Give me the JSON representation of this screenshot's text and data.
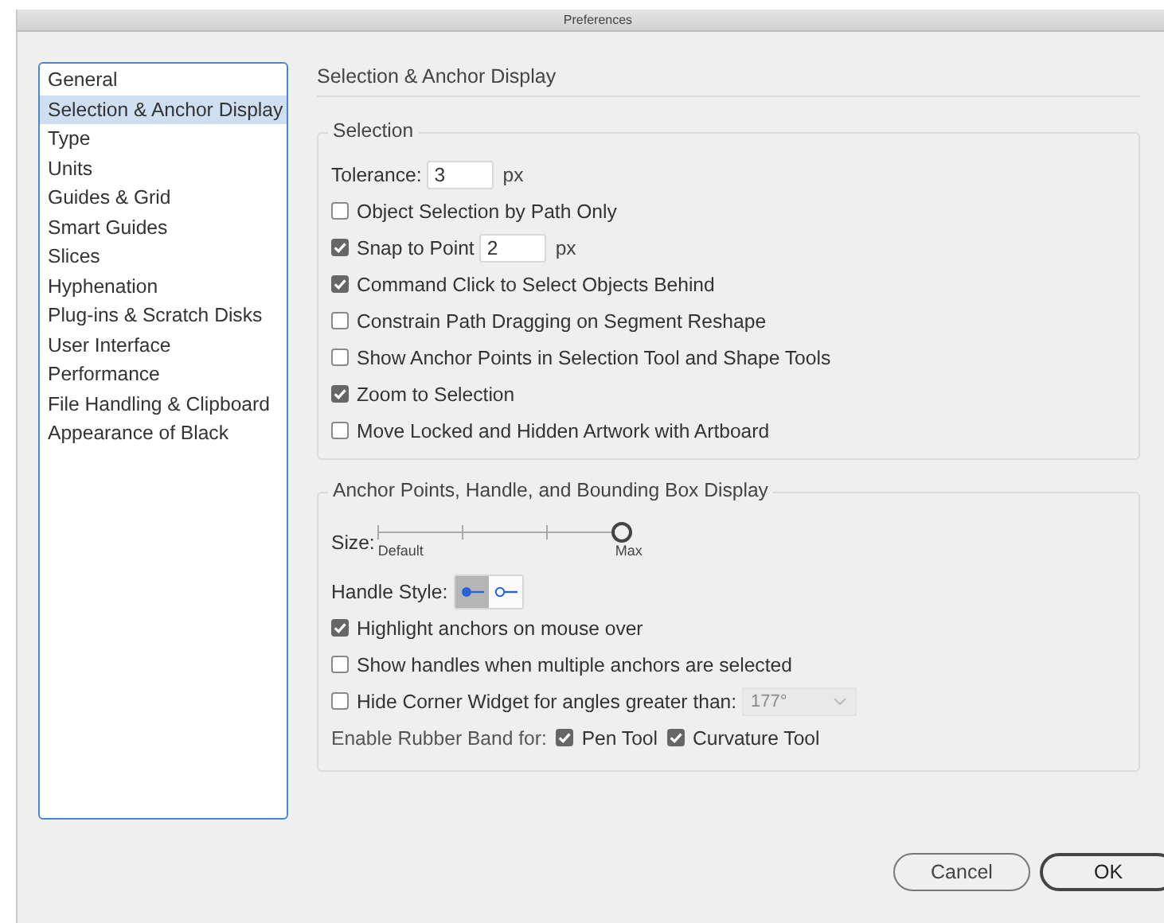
{
  "window": {
    "title": "Preferences"
  },
  "sidebar": {
    "items": [
      {
        "label": "General",
        "selected": false
      },
      {
        "label": "Selection & Anchor Display",
        "selected": true
      },
      {
        "label": "Type",
        "selected": false
      },
      {
        "label": "Units",
        "selected": false
      },
      {
        "label": "Guides & Grid",
        "selected": false
      },
      {
        "label": "Smart Guides",
        "selected": false
      },
      {
        "label": "Slices",
        "selected": false
      },
      {
        "label": "Hyphenation",
        "selected": false
      },
      {
        "label": "Plug-ins & Scratch Disks",
        "selected": false
      },
      {
        "label": "User Interface",
        "selected": false
      },
      {
        "label": "Performance",
        "selected": false
      },
      {
        "label": "File Handling & Clipboard",
        "selected": false
      },
      {
        "label": "Appearance of Black",
        "selected": false
      }
    ]
  },
  "panel_title": "Selection & Anchor Display",
  "selection": {
    "title": "Selection",
    "rows": [
      {
        "kind": "field",
        "label": "Tolerance:",
        "value": "3",
        "unit": "px"
      },
      {
        "kind": "checkbox",
        "label": "Object Selection by Path Only",
        "checked": false
      },
      {
        "kind": "checkbox_field",
        "label": "Snap to Point",
        "checked": true,
        "value": "2",
        "unit": "px"
      },
      {
        "kind": "checkbox",
        "label": "Command Click to Select Objects Behind",
        "checked": true
      },
      {
        "kind": "checkbox",
        "label": "Constrain Path Dragging on Segment Reshape",
        "checked": false
      },
      {
        "kind": "checkbox",
        "label": "Show Anchor Points in Selection Tool and Shape Tools",
        "checked": false
      },
      {
        "kind": "checkbox",
        "label": "Zoom to Selection",
        "checked": true
      },
      {
        "kind": "checkbox",
        "label": "Move Locked and Hidden Artwork with Artboard",
        "checked": false
      }
    ]
  },
  "anchor": {
    "title": "Anchor Points, Handle, and Bounding Box Display",
    "size": {
      "label": "Size:",
      "level": 1,
      "min_label": "Default",
      "max_label": "Max"
    },
    "handle_style": {
      "label": "Handle Style:",
      "options": [
        {
          "kind": "solid",
          "selected": true
        },
        {
          "kind": "hollow",
          "selected": false
        }
      ]
    },
    "rows": [
      {
        "kind": "checkbox",
        "label": "Highlight anchors on mouse over",
        "checked": true
      },
      {
        "kind": "checkbox",
        "label": "Show handles when multiple anchors are selected",
        "checked": false
      },
      {
        "kind": "checkbox_select",
        "label": "Hide Corner Widget for angles greater than:",
        "checked": false,
        "value": "177°",
        "disabled": true
      }
    ],
    "rubber_band": {
      "label": "Enable Rubber Band for:",
      "options": [
        {
          "label": "Pen Tool",
          "checked": true
        },
        {
          "label": "Curvature Tool",
          "checked": true
        }
      ]
    }
  },
  "buttons": [
    {
      "label": "Cancel",
      "default": false
    },
    {
      "label": "OK",
      "default": true
    }
  ]
}
